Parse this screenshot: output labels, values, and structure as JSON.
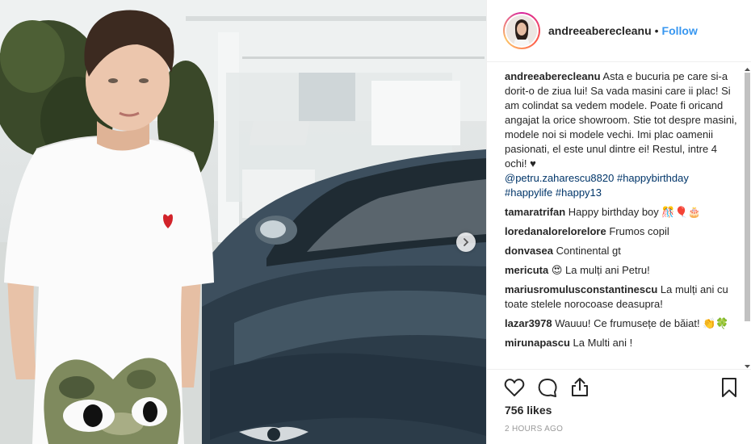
{
  "post": {
    "username": "andreeaberecleanu",
    "follow_label": "Follow",
    "likes": "756 likes",
    "time": "2 HOURS AGO"
  },
  "caption": {
    "username": "andreeaberecleanu",
    "text": "Asta e bucuria pe care si-a dorit-o de ziua lui! Sa vada masini care ii plac! Si am colindat sa vedem modele. Poate fi oricand angajat la orice showroom. Stie tot despre masini, modele noi si modele vechi. Imi plac oamenii pasionati, el este unul dintre ei! Restul, intre 4 ochi! ♥",
    "mention": "@petru.zaharescu8820",
    "tags": [
      "#happybirthday",
      "#happylife",
      "#happy13"
    ]
  },
  "comments": [
    {
      "user": "tamaratrifan",
      "text": "Happy birthday boy 🎊🎈🎂"
    },
    {
      "user": "loredanalorelorelore",
      "text": "Frumos copil"
    },
    {
      "user": "donvasea",
      "text": "Continental gt"
    },
    {
      "user": "mericuta",
      "text": "😍 La mulți ani Petru!"
    },
    {
      "user": "mariusromulusconstantinescu",
      "text": "La mulți ani cu toate stelele norocoase deasupra!"
    },
    {
      "user": "lazar3978",
      "text": "Wauuu! Ce frumusețe de băiat! 👏🍀"
    },
    {
      "user": "mirunapascu",
      "text": "La Multi ani !"
    }
  ],
  "icons": {
    "like": "heart-icon",
    "comment": "comment-icon",
    "share": "share-icon",
    "save": "bookmark-icon",
    "next": "chevron-right-icon"
  },
  "colors": {
    "link": "#003569",
    "follow": "#3897f0",
    "text": "#262626",
    "muted": "#999999"
  }
}
